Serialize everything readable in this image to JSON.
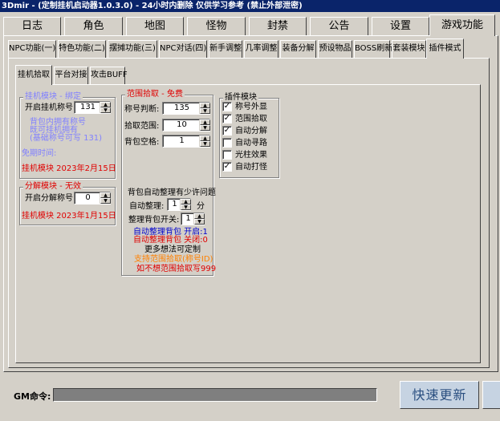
{
  "window": {
    "title": "3Dmir - (定制挂机启动器1.0.3.0) - 24小时内删除  仅供学习参考 (禁止外部泄密)"
  },
  "main_tabs": [
    "日志",
    "角色",
    "地图",
    "怪物",
    "封禁",
    "公告",
    "设置",
    "游戏功能"
  ],
  "sub_tabs": [
    "NPC功能(一)",
    "特色功能(二)",
    "摆摊功能(三)",
    "NPC对话(四)",
    "新手调整",
    "几率调整",
    "装备分解",
    "预设物品",
    "BOSS刷新",
    "套装模块",
    "插件模式"
  ],
  "inner_tabs": [
    "挂机拾取",
    "平台对接",
    "攻击BUFF"
  ],
  "hangup_group": {
    "legend": "挂机模块 - 绑定",
    "title_label": "开启挂机称号",
    "title_value": "131",
    "note1": "背包内拥有称号",
    "note2": "既可挂机拥有",
    "note3": "(基础称号可写 131)",
    "expire_label": "免期时间:",
    "status": "挂机模块  2023年2月15日"
  },
  "decompose_group": {
    "legend": "分解模块 - 无效",
    "label": "开启分解称号",
    "value": "0",
    "status": "挂机模块  2023年1月15日"
  },
  "range_group": {
    "legend": "范围拾取 - 免费",
    "title_check_label": "称号判断:",
    "title_check_value": "135",
    "range_label": "拾取范围:",
    "range_value": "10",
    "bag_label": "背包空格:",
    "bag_value": "1",
    "issue": "背包自动整理有少许问题",
    "auto_sort_label": "自动整理:",
    "auto_sort_value": "1",
    "auto_sort_unit": "分",
    "sort_switch_label": "整理背包开关:",
    "sort_switch_value": "1",
    "info1": "自动整理背包  开启:1",
    "info2": "自动整理背包  关闭:0",
    "info3": "更多想法可定制",
    "info4": "支持范围拾取(称号ID)",
    "info5": "如不想范围拾取写999"
  },
  "plugin_group": {
    "legend": "插件模块",
    "items": [
      {
        "label": "称号外显",
        "checked": true
      },
      {
        "label": "范围拾取",
        "checked": true
      },
      {
        "label": "自动分解",
        "checked": true
      },
      {
        "label": "自动寻路",
        "checked": false
      },
      {
        "label": "光柱效果",
        "checked": false
      },
      {
        "label": "自动打怪",
        "checked": true
      }
    ]
  },
  "gm_label": "GM命令:",
  "update_button": "快速更新",
  "colors": {
    "muted_blue": "#8080ff",
    "red": "#e00000",
    "blue": "#0000cc",
    "orange": "#ff8000"
  }
}
